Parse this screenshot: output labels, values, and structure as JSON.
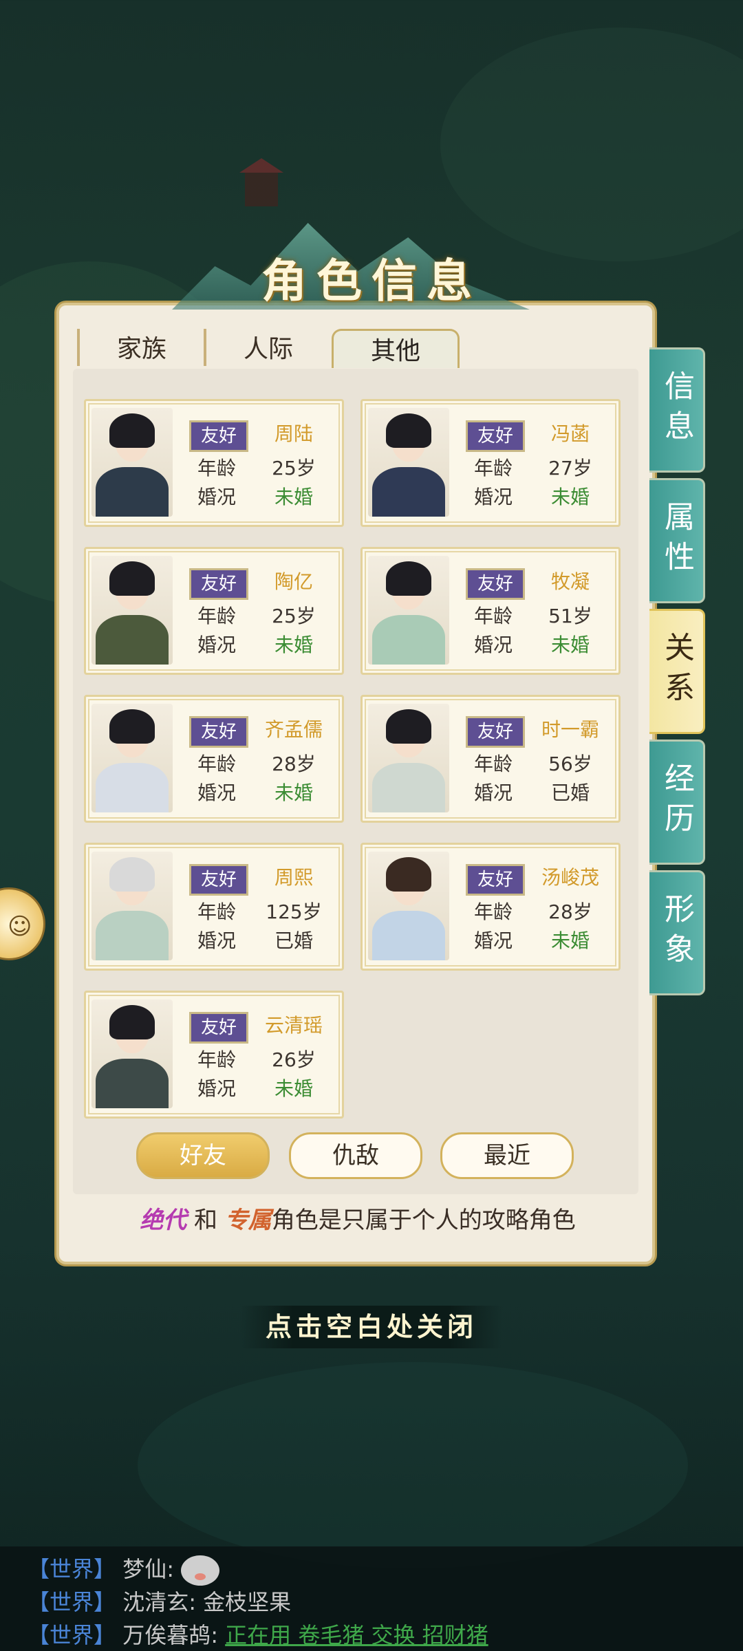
{
  "title": "角色信息",
  "tabs": [
    {
      "label": "家族"
    },
    {
      "label": "人际"
    },
    {
      "label": "其他"
    }
  ],
  "side_tabs": [
    {
      "label": "信息",
      "active": false
    },
    {
      "label": "属性",
      "active": false
    },
    {
      "label": "关系",
      "active": true
    },
    {
      "label": "经历",
      "active": false
    },
    {
      "label": "形象",
      "active": false
    }
  ],
  "labels": {
    "age": "年龄",
    "marriage": "婚况"
  },
  "characters": [
    {
      "badge": "友好",
      "name": "周陆",
      "age": "25岁",
      "status": "未婚"
    },
    {
      "badge": "友好",
      "name": "冯菡",
      "age": "27岁",
      "status": "未婚"
    },
    {
      "badge": "友好",
      "name": "陶亿",
      "age": "25岁",
      "status": "未婚"
    },
    {
      "badge": "友好",
      "name": "牧凝",
      "age": "51岁",
      "status": "未婚"
    },
    {
      "badge": "友好",
      "name": "齐孟儒",
      "age": "28岁",
      "status": "未婚"
    },
    {
      "badge": "友好",
      "name": "时一霸",
      "age": "56岁",
      "status": "已婚"
    },
    {
      "badge": "友好",
      "name": "周熙",
      "age": "125岁",
      "status": "已婚"
    },
    {
      "badge": "友好",
      "name": "汤峻茂",
      "age": "28岁",
      "status": "未婚"
    },
    {
      "badge": "友好",
      "name": "云清瑶",
      "age": "26岁",
      "status": "未婚"
    }
  ],
  "filters": [
    {
      "label": "好友",
      "active": true
    },
    {
      "label": "仇敌",
      "active": false
    },
    {
      "label": "最近",
      "active": false
    }
  ],
  "notice": {
    "tag1": "绝代",
    "and": "和",
    "tag2": "专属",
    "rest": "角色是只属于个人的攻略角色"
  },
  "close_hint": "点击空白处关闭",
  "chat": [
    {
      "channel": "【世界】",
      "user": "梦仙:",
      "text": ""
    },
    {
      "channel": "【世界】",
      "user": "沈清玄:",
      "text": "金枝坚果"
    },
    {
      "channel": "【世界】",
      "user": "万俟暮鸪:",
      "text": "正在用 卷毛猪 交换 招财猪"
    }
  ],
  "colors": {
    "accent": "#d29a2a",
    "badge": "#5e4f93",
    "unmarried": "#3b8c33",
    "side_tab": "#4fa89f"
  }
}
